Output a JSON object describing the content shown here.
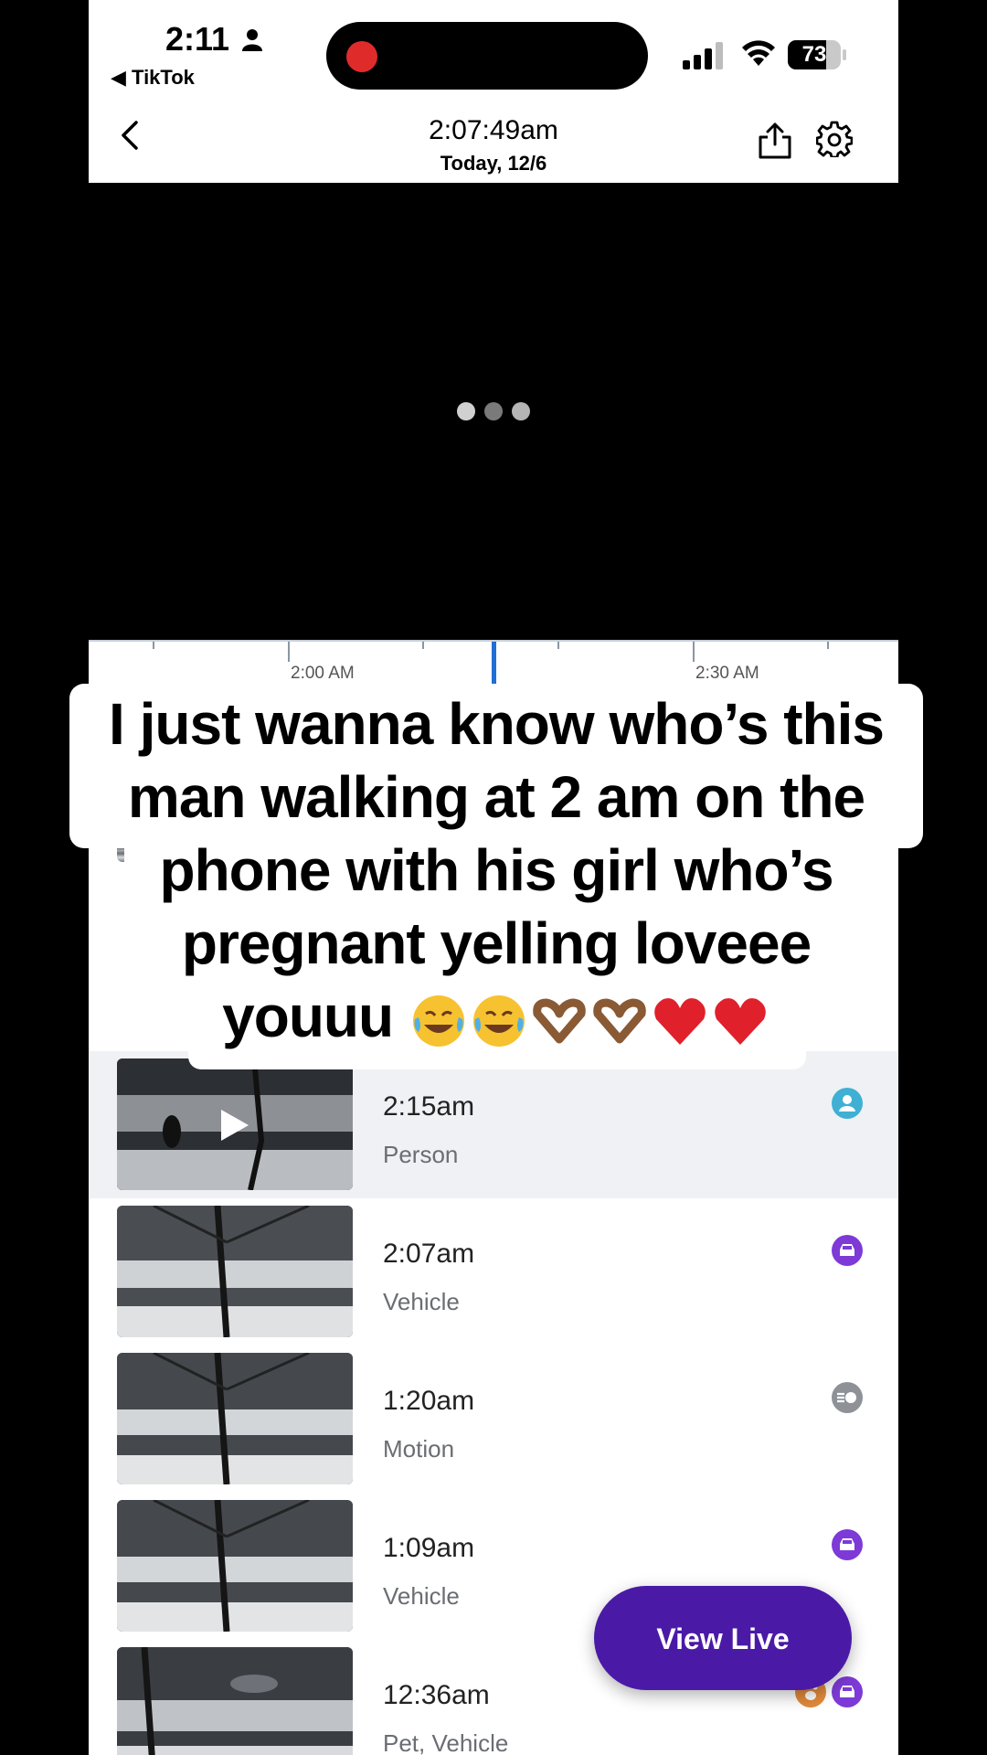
{
  "status_bar": {
    "time": "2:11",
    "back_app": "◀ TikTok",
    "battery": "73",
    "battery_level": 0.73,
    "recording_color": "#e02b2b"
  },
  "header": {
    "time": "2:07:49am",
    "date": "Today, 12/6",
    "icons": [
      "chevron-left-icon",
      "share-icon",
      "gear-icon"
    ]
  },
  "timeline": {
    "labels": [
      "2:00 AM",
      "2:30 AM"
    ],
    "playhead_color": "#1f6fd6"
  },
  "events": [
    {
      "time": "2:15am",
      "type": "Person",
      "icons": [
        "person-icon"
      ],
      "selected": true
    },
    {
      "time": "2:07am",
      "type": "Vehicle",
      "icons": [
        "vehicle-icon"
      ],
      "selected": false
    },
    {
      "time": "1:20am",
      "type": "Motion",
      "icons": [
        "motion-icon"
      ],
      "selected": false
    },
    {
      "time": "1:09am",
      "type": "Vehicle",
      "icons": [
        "vehicle-icon"
      ],
      "selected": false
    },
    {
      "time": "12:36am",
      "type": "Pet, Vehicle",
      "icons": [
        "pet-icon",
        "vehicle-icon"
      ],
      "selected": false
    }
  ],
  "view_live_label": "View Live",
  "colors": {
    "person": "#3fb0d4",
    "vehicle": "#7d3ad6",
    "motion": "#8e9297",
    "pet": "#e08a3c",
    "view_live": "#4a1aa7"
  },
  "caption": {
    "line1": "I just wanna know who’s this",
    "line2": "man walking at 2 am on the",
    "line3": "phone with his girl who’s",
    "line4": "pregnant yelling loveee",
    "line5": "youuu",
    "emojis": [
      "tears-of-joy-emoji",
      "tears-of-joy-emoji",
      "heart-hands-emoji",
      "heart-hands-emoji",
      "red-heart-emoji",
      "red-heart-emoji"
    ]
  }
}
